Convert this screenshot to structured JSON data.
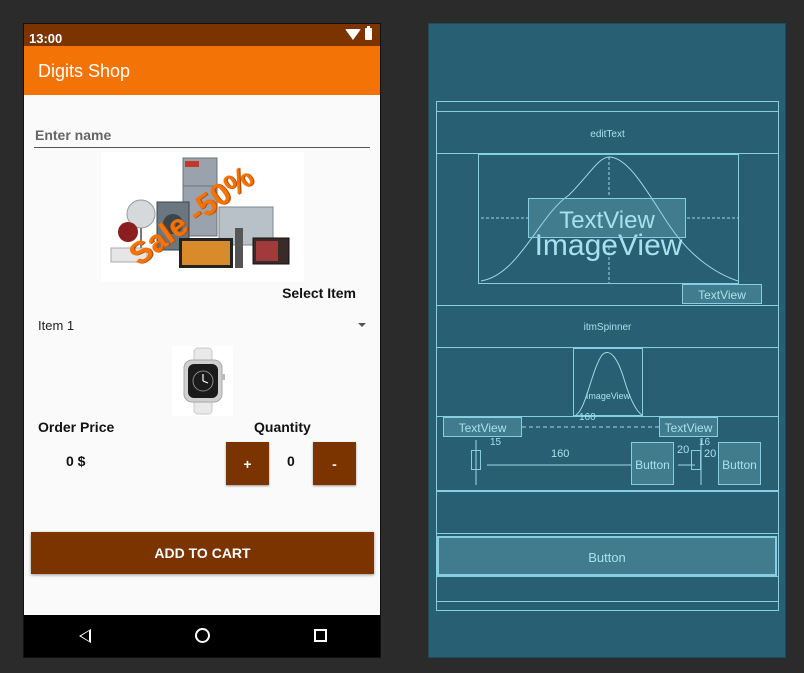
{
  "status_bar": {
    "time": "13:00"
  },
  "app_bar": {
    "title": "Digits Shop"
  },
  "form": {
    "name_placeholder": "Enter name",
    "promo_text": "Sale -50%",
    "select_item_label": "Select Item",
    "spinner_value": "Item 1",
    "order_price_label": "Order Price",
    "quantity_label": "Quantity",
    "price_value": "0 $",
    "plus_label": "+",
    "quantity_value": "0",
    "minus_label": "-",
    "add_to_cart_label": "ADD TO CART"
  },
  "blueprint": {
    "edit_text": "editText",
    "textview_big": "TextView",
    "imageview_big": "ImageView",
    "textview_select": "TextView",
    "spinner": "itmSpinner",
    "imageview_small": "ImageView",
    "textview_order": "TextView",
    "textview_qty": "TextView",
    "dim_160_top": "160",
    "dim_160_mid": "160",
    "dim_20a": "20",
    "dim_20b": "20",
    "dim_15": "15",
    "dim_16": "16",
    "button_plus": "Button",
    "button_minus": "Button",
    "button_cart": "Button"
  },
  "colors": {
    "status_bar": "#7b3300",
    "app_bar": "#f47306",
    "button": "#7b3300",
    "blueprint_bg": "#285f72",
    "blueprint_line": "#86cfe3"
  }
}
